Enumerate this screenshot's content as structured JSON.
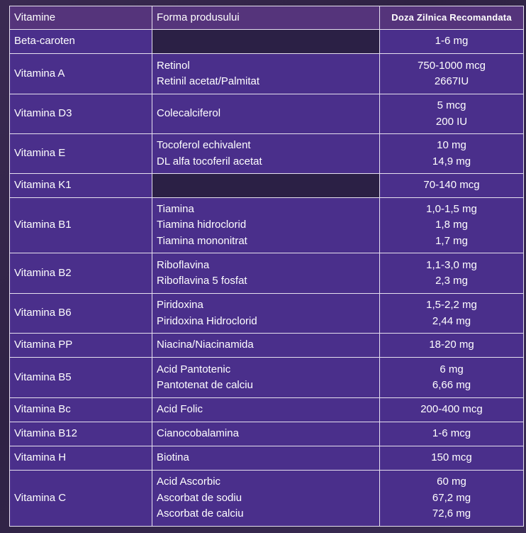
{
  "header": {
    "col1": "Vitamine",
    "col2": "Forma produsului",
    "col3": "Doza Zilnica Recomandata"
  },
  "rows": [
    {
      "vitamin": "Beta-caroten",
      "forms": [],
      "doses": [
        "1-6 mg"
      ]
    },
    {
      "vitamin": "Vitamina A",
      "forms": [
        "Retinol",
        "Retinil acetat/Palmitat"
      ],
      "doses": [
        "750-1000 mcg",
        "2667IU"
      ]
    },
    {
      "vitamin": "Vitamina D3",
      "forms": [
        "Colecalciferol"
      ],
      "doses": [
        "5 mcg",
        "200 IU"
      ]
    },
    {
      "vitamin": "Vitamina E",
      "forms": [
        "Tocoferol echivalent",
        "DL alfa tocoferil acetat"
      ],
      "doses": [
        "10 mg",
        "14,9 mg"
      ]
    },
    {
      "vitamin": "Vitamina K1",
      "forms": [],
      "doses": [
        "70-140 mcg"
      ]
    },
    {
      "vitamin": "Vitamina B1",
      "forms": [
        "Tiamina",
        "Tiamina hidroclorid",
        "Tiamina mononitrat"
      ],
      "doses": [
        "1,0-1,5 mg",
        "1,8 mg",
        "1,7 mg"
      ]
    },
    {
      "vitamin": "Vitamina B2",
      "forms": [
        "Riboflavina",
        "Riboflavina 5 fosfat"
      ],
      "doses": [
        "1,1-3,0 mg",
        "2,3 mg"
      ]
    },
    {
      "vitamin": "Vitamina B6",
      "forms": [
        "Piridoxina",
        "Piridoxina Hidroclorid"
      ],
      "doses": [
        "1,5-2,2 mg",
        "2,44 mg"
      ]
    },
    {
      "vitamin": "Vitamina PP",
      "forms": [
        "Niacina/Niacinamida"
      ],
      "doses": [
        "18-20 mg"
      ]
    },
    {
      "vitamin": "Vitamina B5",
      "forms": [
        "Acid Pantotenic",
        "Pantotenat de calciu"
      ],
      "doses": [
        "6 mg",
        "6,66 mg"
      ]
    },
    {
      "vitamin": "Vitamina Bc",
      "forms": [
        "Acid Folic"
      ],
      "doses": [
        "200-400 mcg"
      ]
    },
    {
      "vitamin": "Vitamina B12",
      "forms": [
        "Cianocobalamina"
      ],
      "doses": [
        "1-6 mcg"
      ]
    },
    {
      "vitamin": "Vitamina H",
      "forms": [
        "Biotina"
      ],
      "doses": [
        "150 mcg"
      ]
    },
    {
      "vitamin": "Vitamina C",
      "forms": [
        "Acid Ascorbic",
        "Ascorbat de sodiu",
        "Ascorbat de calciu"
      ],
      "doses": [
        "60 mg",
        "67,2 mg",
        "72,6 mg"
      ]
    }
  ]
}
